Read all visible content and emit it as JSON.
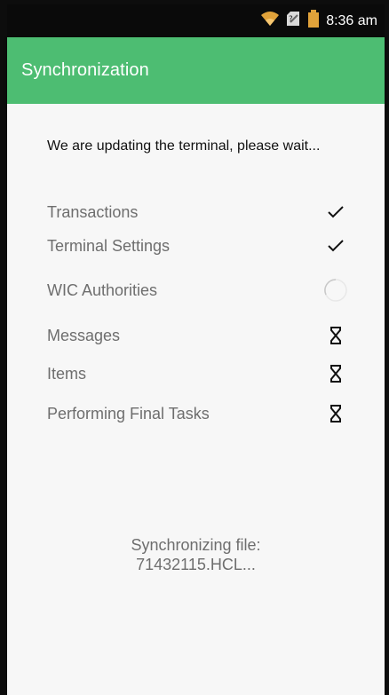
{
  "status_bar": {
    "time": "8:36 am",
    "icons": [
      "wifi-icon",
      "sim-card-icon",
      "battery-icon"
    ],
    "accent_color": "#e0a23a"
  },
  "app_bar": {
    "title": "Synchronization",
    "color": "#4dbd72"
  },
  "main": {
    "intro_text": "We are updating the terminal, please wait...",
    "tasks": [
      {
        "label": "Transactions",
        "status": "done",
        "icon": "checkmark-icon"
      },
      {
        "label": "Terminal Settings",
        "status": "done",
        "icon": "checkmark-icon"
      },
      {
        "label": "WIC Authorities",
        "status": "in-progress",
        "icon": "spinner-icon"
      },
      {
        "label": "Messages",
        "status": "pending",
        "icon": "hourglass-icon"
      },
      {
        "label": "Items",
        "status": "pending",
        "icon": "hourglass-icon"
      },
      {
        "label": "Performing Final Tasks",
        "status": "pending",
        "icon": "hourglass-icon"
      }
    ],
    "sync_label": "Synchronizing file:",
    "sync_file": "71432115.HCL..."
  }
}
